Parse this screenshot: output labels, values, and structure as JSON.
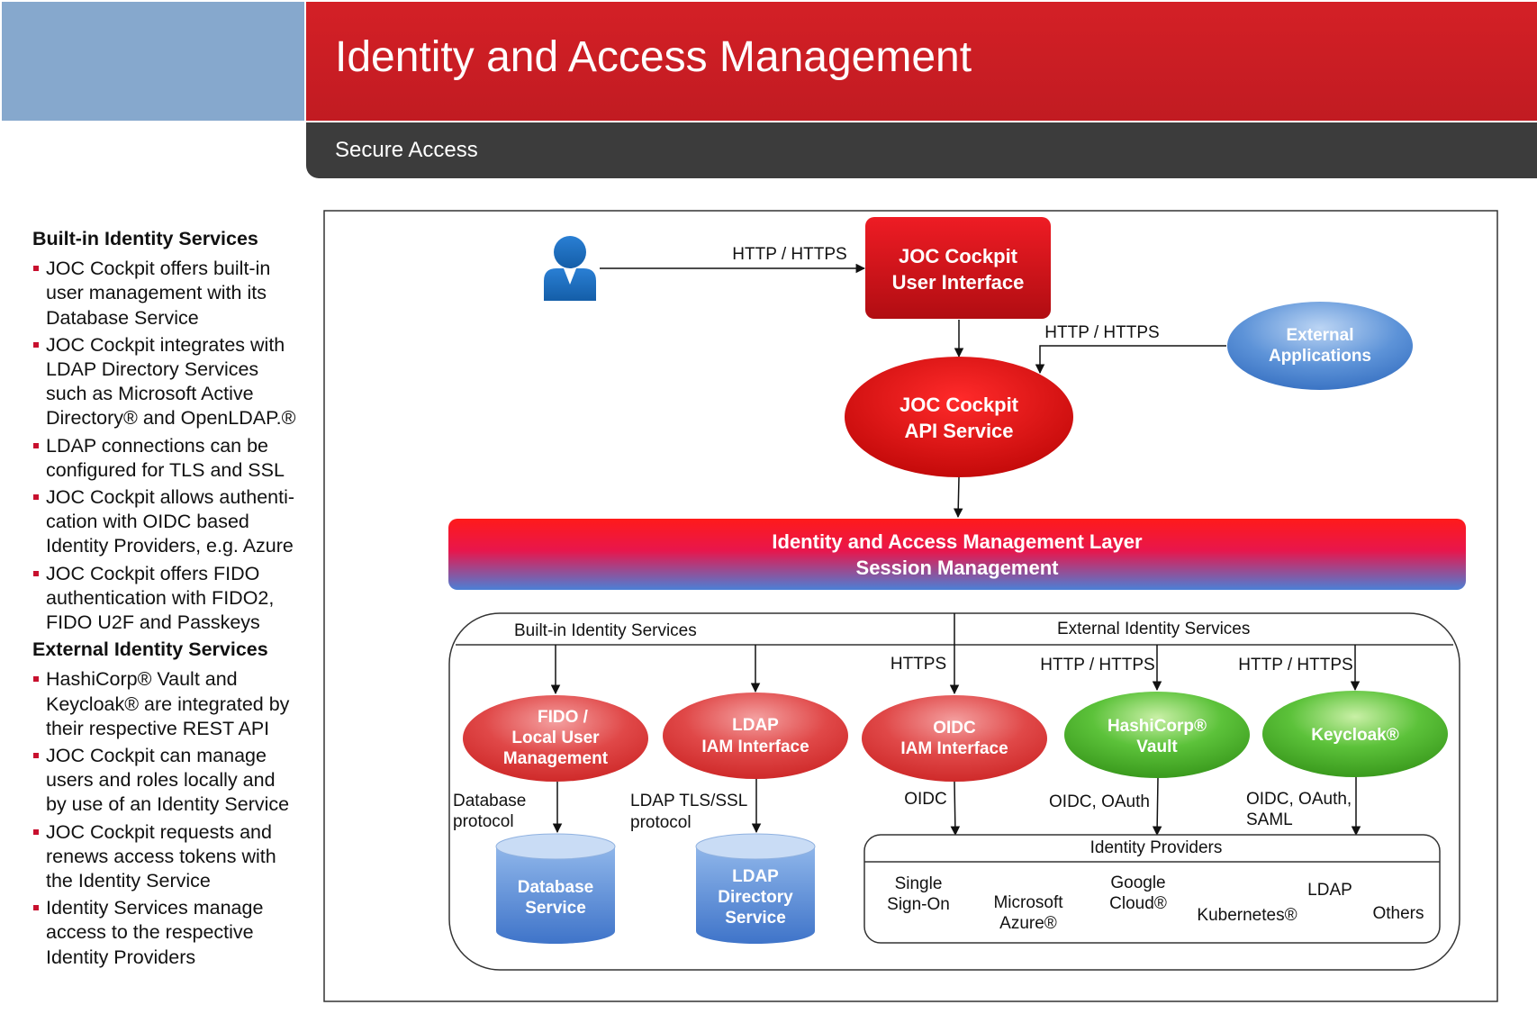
{
  "header": {
    "title": "Identity and Access Management",
    "subtitle": "Secure Access"
  },
  "left_panel": {
    "sections": [
      {
        "heading": "Built-in Identity Services",
        "bullets": [
          [
            "JOC Cockpit offers built-in",
            "user management with its",
            "Database Service"
          ],
          [
            "JOC Cockpit integrates with",
            "LDAP Directory Services",
            "such as Microsoft Active",
            "Directory® and OpenLDAP.®"
          ],
          [
            "LDAP connections can be",
            "configured for TLS and SSL"
          ],
          [
            "JOC Cockpit allows authenti-",
            "cation with OIDC based",
            "Identity Providers, e.g. Azure"
          ],
          [
            "JOC Cockpit offers FIDO",
            "authentication with FIDO2,",
            "FIDO U2F and Passkeys"
          ]
        ]
      },
      {
        "heading": "External Identity Services",
        "bullets": [
          [
            "HashiCorp® Vault and",
            "Keycloak® are integrated by",
            "their respective REST API"
          ],
          [
            "JOC Cockpit can manage",
            "users and roles locally and",
            "by use of an Identity Service"
          ],
          [
            "JOC Cockpit requests and",
            "renews access tokens with",
            "the Identity Service"
          ],
          [
            "Identity Services manage",
            "access to the respective",
            "Identity Providers"
          ]
        ]
      }
    ]
  },
  "diagram": {
    "user_icon": "user-icon",
    "ui_box": [
      "JOC Cockpit",
      "User Interface"
    ],
    "api_service": [
      "JOC Cockpit",
      "API Service"
    ],
    "external_apps": [
      "External",
      "Applications"
    ],
    "http_https": "HTTP / HTTPS",
    "https": "HTTPS",
    "iam_layer": [
      "Identity and Access Management Layer",
      "Session Management"
    ],
    "builtin_label": "Built-in Identity Services",
    "external_label": "External Identity Services",
    "fido": [
      "FIDO /",
      "Local User",
      "Management"
    ],
    "ldap_iam": [
      "LDAP",
      "IAM Interface"
    ],
    "oidc_iam": [
      "OIDC",
      "IAM Interface"
    ],
    "vault": [
      "HashiCorp®",
      "Vault"
    ],
    "keycloak": "Keycloak®",
    "db_protocol": [
      "Database",
      "protocol"
    ],
    "ldap_protocol": [
      "LDAP TLS/SSL",
      "protocol"
    ],
    "oidc": "OIDC",
    "oidc_oauth": "OIDC, OAuth",
    "oidc_oauth_saml": [
      "OIDC, OAuth,",
      "SAML"
    ],
    "database_service": [
      "Database",
      "Service"
    ],
    "ldap_directory": [
      "LDAP",
      "Directory",
      "Service"
    ],
    "idp_title": "Identity Providers",
    "idp_sso": [
      "Single",
      "Sign-On"
    ],
    "idp_azure": [
      "Microsoft",
      "Azure®"
    ],
    "idp_google": [
      "Google",
      "Cloud®"
    ],
    "idp_k8s": "Kubernetes®",
    "idp_ldap": "LDAP",
    "idp_others": "Others",
    "colors": {
      "brand_red": "#c8102e",
      "header_blue": "#86a8cd",
      "header_grey": "#3c3c3c",
      "node_blue": "#4f86d0",
      "node_green": "#3fa822"
    }
  }
}
